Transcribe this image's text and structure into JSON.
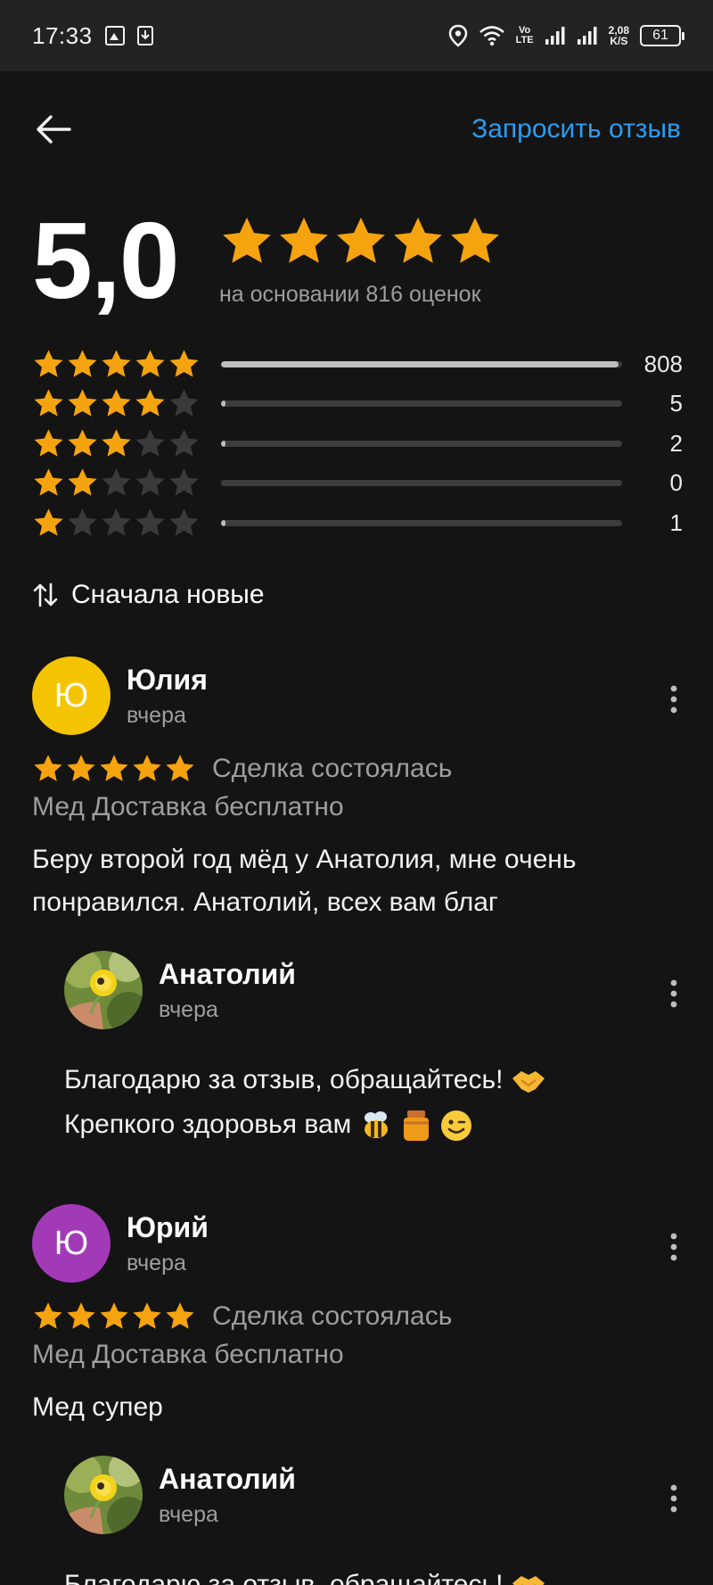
{
  "status_bar": {
    "time": "17:33",
    "network_speed_value": "2,08",
    "network_speed_unit": "K/S",
    "battery": "61",
    "volte": "Vo\nLTE"
  },
  "header": {
    "request_review_label": "Запросить отзыв"
  },
  "summary": {
    "rating": "5,0",
    "based_on": "на основании 816 оценок",
    "star_color": "#f5a30f"
  },
  "distribution": [
    {
      "stars": 5,
      "count": "808",
      "fraction": 0.99
    },
    {
      "stars": 4,
      "count": "5",
      "fraction": 0.006
    },
    {
      "stars": 3,
      "count": "2",
      "fraction": 0.003
    },
    {
      "stars": 2,
      "count": "0",
      "fraction": 0.0
    },
    {
      "stars": 1,
      "count": "1",
      "fraction": 0.002
    }
  ],
  "sort": {
    "label": "Сначала новые"
  },
  "reviews": [
    {
      "initial": "Ю",
      "avatar_color": "#f5c400",
      "name": "Юлия",
      "date": "вчера",
      "stars": 5,
      "status": "Сделка состоялась",
      "product": "Мед Доставка бесплатно",
      "text": "Беру второй год мёд у Анатолия, мне очень понравился. Анатолий, всех вам благ",
      "reply": {
        "name": "Анатолий",
        "date": "вчера",
        "line1": "Благодарю за отзыв, обращайтесь!",
        "line2": "Крепкого здоровья вам"
      }
    },
    {
      "initial": "Ю",
      "avatar_color": "#a23ab8",
      "name": "Юрий",
      "date": "вчера",
      "stars": 5,
      "status": "Сделка состоялась",
      "product": "Мед Доставка бесплатно",
      "text": "Мед супер",
      "reply": {
        "name": "Анатолий",
        "date": "вчера",
        "line1": "Благодарю за отзыв, обращайтесь!"
      }
    }
  ]
}
